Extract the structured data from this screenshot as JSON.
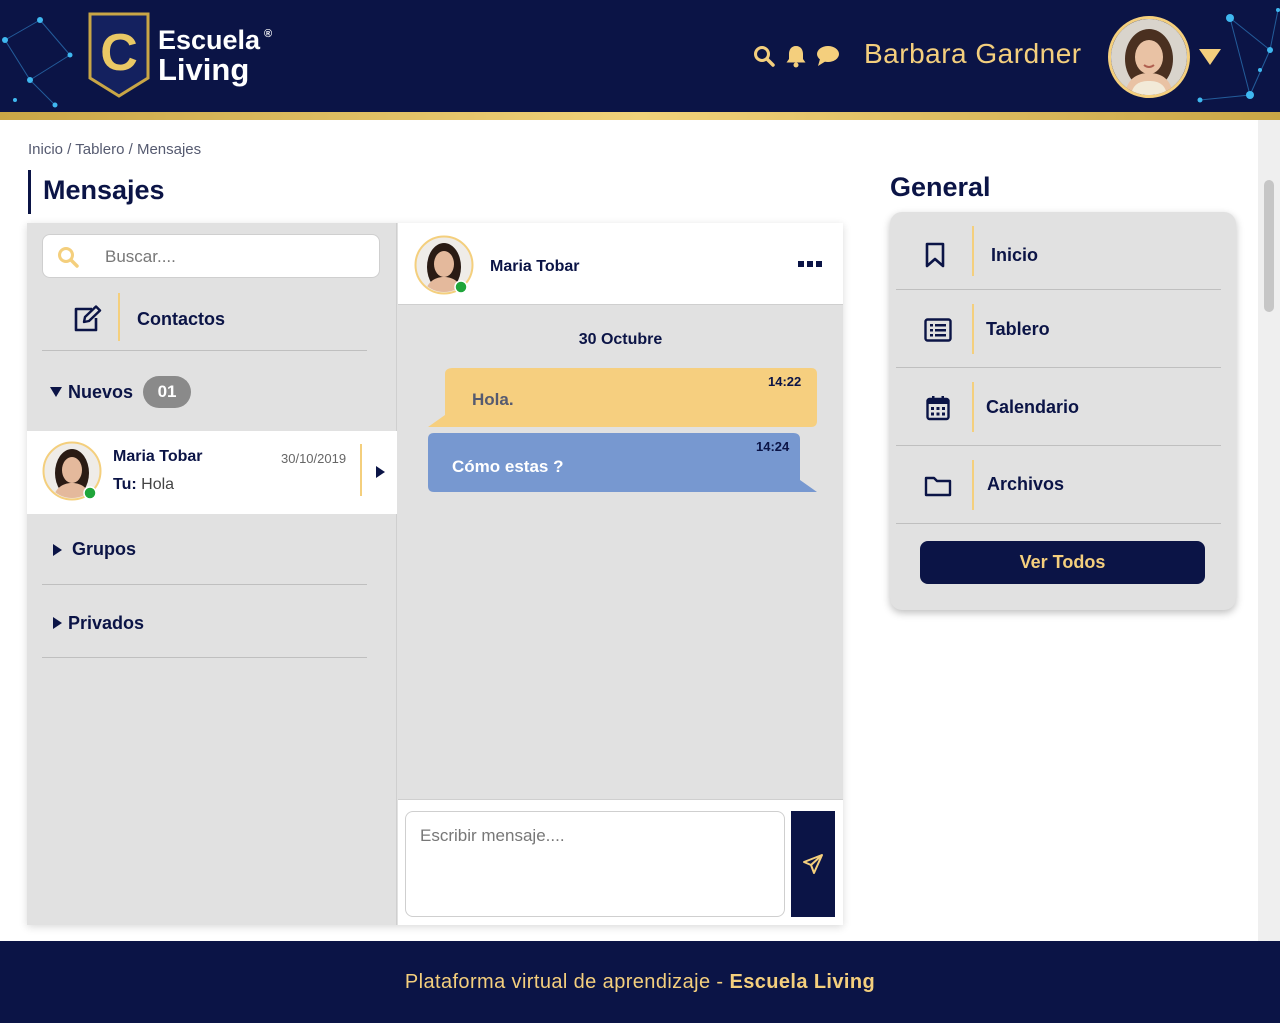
{
  "header": {
    "logo_line1": "Escuela",
    "logo_line2": "Living",
    "logo_reg": "®",
    "logo_letter": "C",
    "icons": [
      "search-icon",
      "bell-icon",
      "chat-icon"
    ],
    "user_name": "Barbara Gardner"
  },
  "breadcrumb": "Inicio / Tablero / Mensajes",
  "page_title": "Mensajes",
  "contacts": {
    "search_placeholder": "Buscar....",
    "contactos_label": "Contactos",
    "nuevos_label": "Nuevos",
    "nuevos_count": "01",
    "conversation": {
      "name": "Maria Tobar",
      "date": "30/10/2019",
      "preview_prefix": "Tu:",
      "preview_text": "Hola"
    },
    "grupos_label": "Grupos",
    "privados_label": "Privados"
  },
  "chat": {
    "contact_name": "Maria Tobar",
    "date_label": "30 Octubre",
    "messages": [
      {
        "text": "Hola.",
        "time": "14:22",
        "direction": "out",
        "color": "#f6cf7f"
      },
      {
        "text": "Cómo estas ?",
        "time": "14:24",
        "direction": "in",
        "color": "#7798d0"
      }
    ],
    "compose_placeholder": "Escribir mensaje...."
  },
  "general": {
    "title": "General",
    "items": [
      {
        "label": "Inicio",
        "icon": "bookmark-icon"
      },
      {
        "label": "Tablero",
        "icon": "list-icon"
      },
      {
        "label": "Calendario",
        "icon": "calendar-icon"
      },
      {
        "label": "Archivos",
        "icon": "folder-icon"
      }
    ],
    "button_label": "Ver Todos"
  },
  "footer": {
    "text": "Plataforma virtual de aprendizaje - ",
    "brand": "Escuela Living"
  },
  "colors": {
    "navy": "#0b1446",
    "gold": "#f4cf7d",
    "panel_gray": "#e1e1e1",
    "bubble_out": "#f6cf7f",
    "bubble_in": "#7798d0",
    "online": "#1fa53a"
  }
}
